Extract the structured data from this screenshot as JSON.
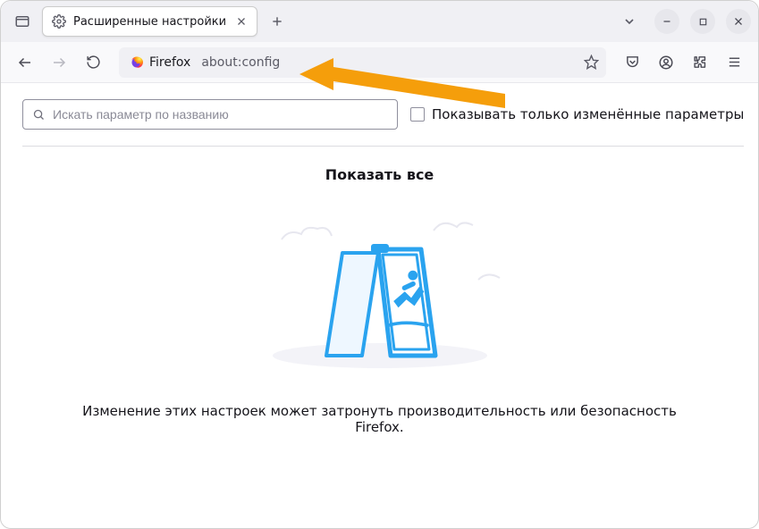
{
  "tab": {
    "title": "Расширенные настройки"
  },
  "identity": {
    "label": "Firefox"
  },
  "url": "about:config",
  "search": {
    "placeholder": "Искать параметр по названию"
  },
  "checkbox": {
    "label": "Показывать только изменённые параметры"
  },
  "show_all": "Показать все",
  "warning": "Изменение этих настроек может затронуть производительность или безопасность Firefox."
}
